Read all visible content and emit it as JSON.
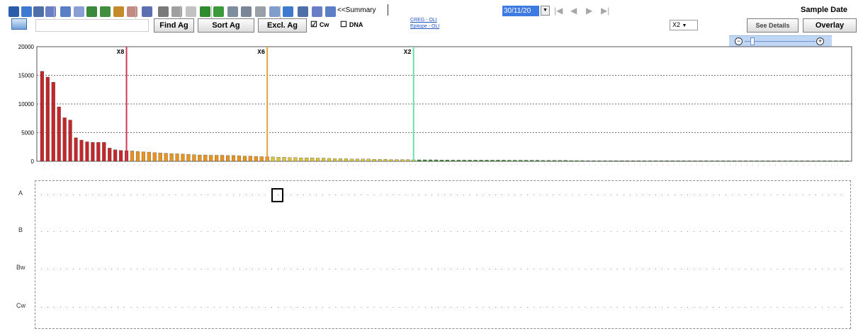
{
  "toolbar": {
    "summary_label": "<<Summary",
    "date_value": "30/11/20",
    "sample_date_label": "Sample Date",
    "x2_value": "X2",
    "overlay_label": "Overlay",
    "see_details_label": "See Details",
    "icon_colors": [
      "#2a5cab",
      "#3d7ad0",
      "#4f6fa8",
      "#6a7ec6",
      "#5a7fc7",
      "#8aa0d4",
      "#3b8a3b",
      "#3f8f3f",
      "#c58b2a",
      "#9c3a2c",
      "#5b6fb1",
      "#7a7a7a",
      "#a0a0a0",
      "#9a9a9a",
      "#2e8b2e",
      "#3c9a3c",
      "#7f8e9f",
      "#7a8796",
      "#9aa0a8"
    ]
  },
  "controls": {
    "find_label": "Find Ag",
    "sort_label": "Sort Ag",
    "excl_label": "Excl. Ag",
    "cw_label": "Cw",
    "cw_checked": "☑",
    "dna_label": "DNA",
    "dna_checked": "☐",
    "creg_link": "CREG - OLI",
    "epitope_link": "Epitope - OLI"
  },
  "chart_data": {
    "type": "bar",
    "ylim": [
      0,
      20000
    ],
    "yticks": [
      "20000",
      "15000",
      "10000",
      "5000",
      "0"
    ],
    "markers": [
      {
        "label": "X8",
        "index": 15,
        "color": "#d2385a"
      },
      {
        "label": "X6",
        "index": 40,
        "color": "#e3a33a"
      },
      {
        "label": "X2",
        "index": 66,
        "color": "#68e0a8"
      }
    ],
    "values": [
      15700,
      14700,
      13800,
      9500,
      7600,
      7200,
      4100,
      3700,
      3400,
      3300,
      3300,
      3300,
      2300,
      2000,
      1900,
      1850,
      1800,
      1700,
      1650,
      1600,
      1500,
      1450,
      1400,
      1350,
      1300,
      1250,
      1200,
      1150,
      1100,
      1100,
      1050,
      1050,
      1050,
      1000,
      1000,
      950,
      900,
      900,
      850,
      800,
      800,
      750,
      700,
      700,
      650,
      650,
      600,
      600,
      600,
      550,
      550,
      500,
      450,
      450,
      450,
      400,
      400,
      400,
      400,
      350,
      350,
      350,
      300,
      300,
      300,
      300,
      250,
      250,
      250,
      250,
      250,
      220,
      220,
      200,
      200,
      200,
      200,
      200,
      200,
      200,
      200,
      200,
      200,
      180,
      180,
      180,
      180,
      180,
      180,
      150,
      150,
      150,
      150,
      150,
      120,
      120,
      120,
      100,
      100,
      100,
      100,
      100,
      100,
      100,
      100,
      100,
      100,
      100,
      100,
      100,
      100,
      100,
      100,
      90,
      90,
      90,
      90,
      90,
      90,
      80,
      80,
      80,
      80,
      80,
      80,
      80,
      80,
      80,
      80,
      80,
      80,
      80,
      80,
      80,
      80,
      80,
      80,
      80,
      80,
      80,
      80,
      80,
      80,
      80
    ]
  },
  "rows": {
    "a_label": "A",
    "b_label": "B",
    "bw_label": "Bw",
    "cw_label": "Cw"
  }
}
